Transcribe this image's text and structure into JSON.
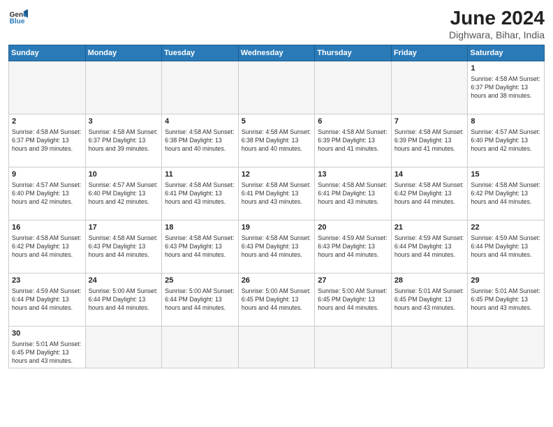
{
  "header": {
    "logo_general": "General",
    "logo_blue": "Blue",
    "title": "June 2024",
    "subtitle": "Dighwara, Bihar, India"
  },
  "weekdays": [
    "Sunday",
    "Monday",
    "Tuesday",
    "Wednesday",
    "Thursday",
    "Friday",
    "Saturday"
  ],
  "weeks": [
    [
      {
        "date": "",
        "info": ""
      },
      {
        "date": "",
        "info": ""
      },
      {
        "date": "",
        "info": ""
      },
      {
        "date": "",
        "info": ""
      },
      {
        "date": "",
        "info": ""
      },
      {
        "date": "",
        "info": ""
      },
      {
        "date": "1",
        "info": "Sunrise: 4:58 AM\nSunset: 6:37 PM\nDaylight: 13 hours\nand 38 minutes."
      }
    ],
    [
      {
        "date": "2",
        "info": "Sunrise: 4:58 AM\nSunset: 6:37 PM\nDaylight: 13 hours\nand 39 minutes."
      },
      {
        "date": "3",
        "info": "Sunrise: 4:58 AM\nSunset: 6:37 PM\nDaylight: 13 hours\nand 39 minutes."
      },
      {
        "date": "4",
        "info": "Sunrise: 4:58 AM\nSunset: 6:38 PM\nDaylight: 13 hours\nand 40 minutes."
      },
      {
        "date": "5",
        "info": "Sunrise: 4:58 AM\nSunset: 6:38 PM\nDaylight: 13 hours\nand 40 minutes."
      },
      {
        "date": "6",
        "info": "Sunrise: 4:58 AM\nSunset: 6:39 PM\nDaylight: 13 hours\nand 41 minutes."
      },
      {
        "date": "7",
        "info": "Sunrise: 4:58 AM\nSunset: 6:39 PM\nDaylight: 13 hours\nand 41 minutes."
      },
      {
        "date": "8",
        "info": "Sunrise: 4:57 AM\nSunset: 6:40 PM\nDaylight: 13 hours\nand 42 minutes."
      }
    ],
    [
      {
        "date": "9",
        "info": "Sunrise: 4:57 AM\nSunset: 6:40 PM\nDaylight: 13 hours\nand 42 minutes."
      },
      {
        "date": "10",
        "info": "Sunrise: 4:57 AM\nSunset: 6:40 PM\nDaylight: 13 hours\nand 42 minutes."
      },
      {
        "date": "11",
        "info": "Sunrise: 4:58 AM\nSunset: 6:41 PM\nDaylight: 13 hours\nand 43 minutes."
      },
      {
        "date": "12",
        "info": "Sunrise: 4:58 AM\nSunset: 6:41 PM\nDaylight: 13 hours\nand 43 minutes."
      },
      {
        "date": "13",
        "info": "Sunrise: 4:58 AM\nSunset: 6:41 PM\nDaylight: 13 hours\nand 43 minutes."
      },
      {
        "date": "14",
        "info": "Sunrise: 4:58 AM\nSunset: 6:42 PM\nDaylight: 13 hours\nand 44 minutes."
      },
      {
        "date": "15",
        "info": "Sunrise: 4:58 AM\nSunset: 6:42 PM\nDaylight: 13 hours\nand 44 minutes."
      }
    ],
    [
      {
        "date": "16",
        "info": "Sunrise: 4:58 AM\nSunset: 6:42 PM\nDaylight: 13 hours\nand 44 minutes."
      },
      {
        "date": "17",
        "info": "Sunrise: 4:58 AM\nSunset: 6:43 PM\nDaylight: 13 hours\nand 44 minutes."
      },
      {
        "date": "18",
        "info": "Sunrise: 4:58 AM\nSunset: 6:43 PM\nDaylight: 13 hours\nand 44 minutes."
      },
      {
        "date": "19",
        "info": "Sunrise: 4:58 AM\nSunset: 6:43 PM\nDaylight: 13 hours\nand 44 minutes."
      },
      {
        "date": "20",
        "info": "Sunrise: 4:59 AM\nSunset: 6:43 PM\nDaylight: 13 hours\nand 44 minutes."
      },
      {
        "date": "21",
        "info": "Sunrise: 4:59 AM\nSunset: 6:44 PM\nDaylight: 13 hours\nand 44 minutes."
      },
      {
        "date": "22",
        "info": "Sunrise: 4:59 AM\nSunset: 6:44 PM\nDaylight: 13 hours\nand 44 minutes."
      }
    ],
    [
      {
        "date": "23",
        "info": "Sunrise: 4:59 AM\nSunset: 6:44 PM\nDaylight: 13 hours\nand 44 minutes."
      },
      {
        "date": "24",
        "info": "Sunrise: 5:00 AM\nSunset: 6:44 PM\nDaylight: 13 hours\nand 44 minutes."
      },
      {
        "date": "25",
        "info": "Sunrise: 5:00 AM\nSunset: 6:44 PM\nDaylight: 13 hours\nand 44 minutes."
      },
      {
        "date": "26",
        "info": "Sunrise: 5:00 AM\nSunset: 6:45 PM\nDaylight: 13 hours\nand 44 minutes."
      },
      {
        "date": "27",
        "info": "Sunrise: 5:00 AM\nSunset: 6:45 PM\nDaylight: 13 hours\nand 44 minutes."
      },
      {
        "date": "28",
        "info": "Sunrise: 5:01 AM\nSunset: 6:45 PM\nDaylight: 13 hours\nand 43 minutes."
      },
      {
        "date": "29",
        "info": "Sunrise: 5:01 AM\nSunset: 6:45 PM\nDaylight: 13 hours\nand 43 minutes."
      }
    ],
    [
      {
        "date": "30",
        "info": "Sunrise: 5:01 AM\nSunset: 6:45 PM\nDaylight: 13 hours\nand 43 minutes."
      },
      {
        "date": "",
        "info": ""
      },
      {
        "date": "",
        "info": ""
      },
      {
        "date": "",
        "info": ""
      },
      {
        "date": "",
        "info": ""
      },
      {
        "date": "",
        "info": ""
      },
      {
        "date": "",
        "info": ""
      }
    ]
  ]
}
